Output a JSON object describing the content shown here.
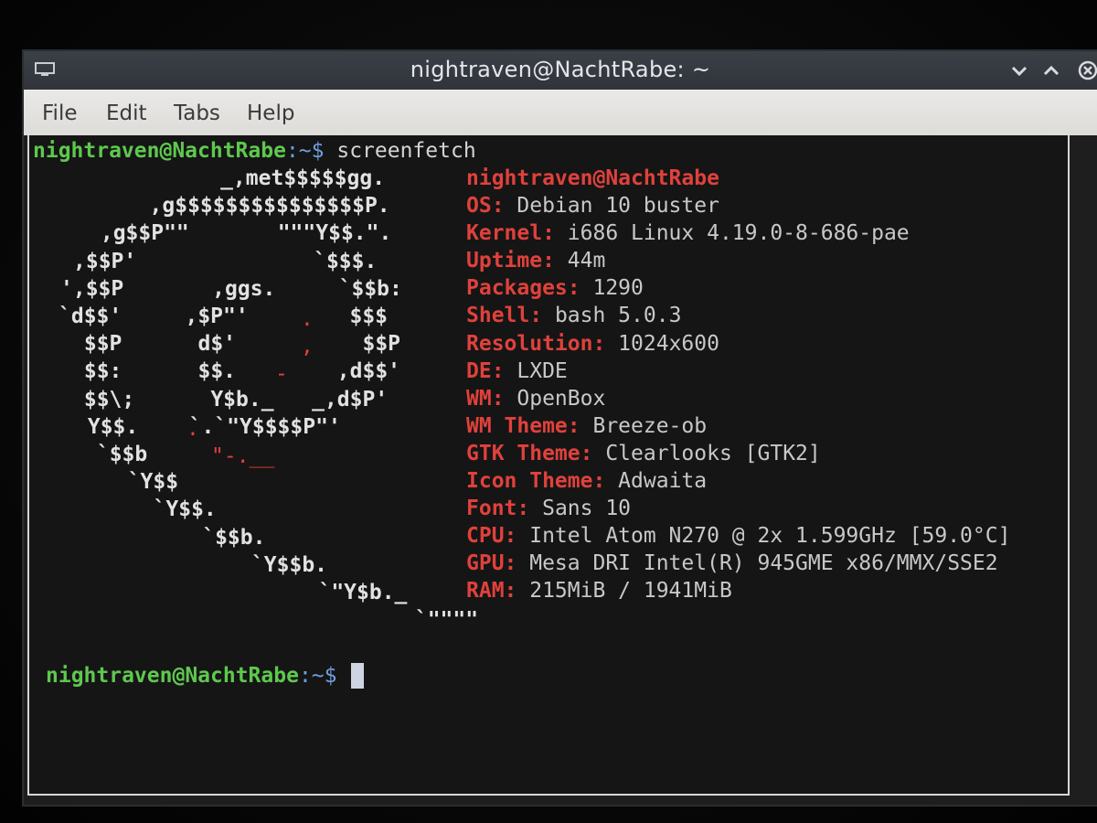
{
  "window": {
    "title": "nightraven@NachtRabe: ~"
  },
  "menu": {
    "file": "File",
    "edit": "Edit",
    "tabs": "Tabs",
    "help": "Help"
  },
  "prompt": {
    "user_host": "nightraven@NachtRabe",
    "path_sep": ":~$ ",
    "command": "screenfetch"
  },
  "art": {
    "lines": [
      "      _,met$$$$$gg.",
      "   ,g$$$$$$$$$$$$$$$P.",
      " ,g$$P\"\"       \"\"\"Y$$.\".",
      ",$$P'              `$$$.",
      "',$$P       ,ggs.     `$$b:",
      "`d$$'     ,$P\"'        $$$",
      " $$P      d$'          $$P",
      " $$:      $$.        ,d$$'",
      " $$\\;      Y$b._   _,d$P'",
      " Y$$.    `.`\"Y$$$$P\"'",
      " `$$b      ",
      "  `Y$$",
      "   `Y$$.",
      "     `$$b.",
      "       `Y$$b.",
      "          `\"Y$b._",
      "              `\"\"\"\""
    ],
    "red_marks": [
      ".",
      ",",
      "-",
      ".",
      "\"-.__"
    ]
  },
  "info": {
    "user_host": "nightraven@NachtRabe",
    "rows": [
      {
        "label": "OS:",
        "value": " Debian 10 buster"
      },
      {
        "label": "Kernel:",
        "value": " i686 Linux 4.19.0-8-686-pae"
      },
      {
        "label": "Uptime:",
        "value": " 44m"
      },
      {
        "label": "Packages:",
        "value": " 1290"
      },
      {
        "label": "Shell:",
        "value": " bash 5.0.3"
      },
      {
        "label": "Resolution:",
        "value": " 1024x600"
      },
      {
        "label": "DE:",
        "value": " LXDE"
      },
      {
        "label": "WM:",
        "value": " OpenBox"
      },
      {
        "label": "WM Theme:",
        "value": " Breeze-ob"
      },
      {
        "label": "GTK Theme:",
        "value": " Clearlooks [GTK2]"
      },
      {
        "label": "Icon Theme:",
        "value": " Adwaita"
      },
      {
        "label": "Font:",
        "value": " Sans 10"
      },
      {
        "label": "CPU:",
        "value": " Intel Atom N270 @ 2x 1.599GHz [59.0°C]"
      },
      {
        "label": "GPU:",
        "value": " Mesa DRI Intel(R) 945GME x86/MMX/SSE2"
      },
      {
        "label": "RAM:",
        "value": " 215MiB / 1941MiB"
      }
    ]
  },
  "prompt2": {
    "user_host": "nightraven@NachtRabe",
    "path_sep": ":~$ "
  },
  "colors": {
    "prompt_user": "#5ec84e",
    "prompt_path": "#6f9fe0",
    "info_label": "#e0413c",
    "terminal_bg": "#151515",
    "titlebar_bg": "#33373d"
  }
}
